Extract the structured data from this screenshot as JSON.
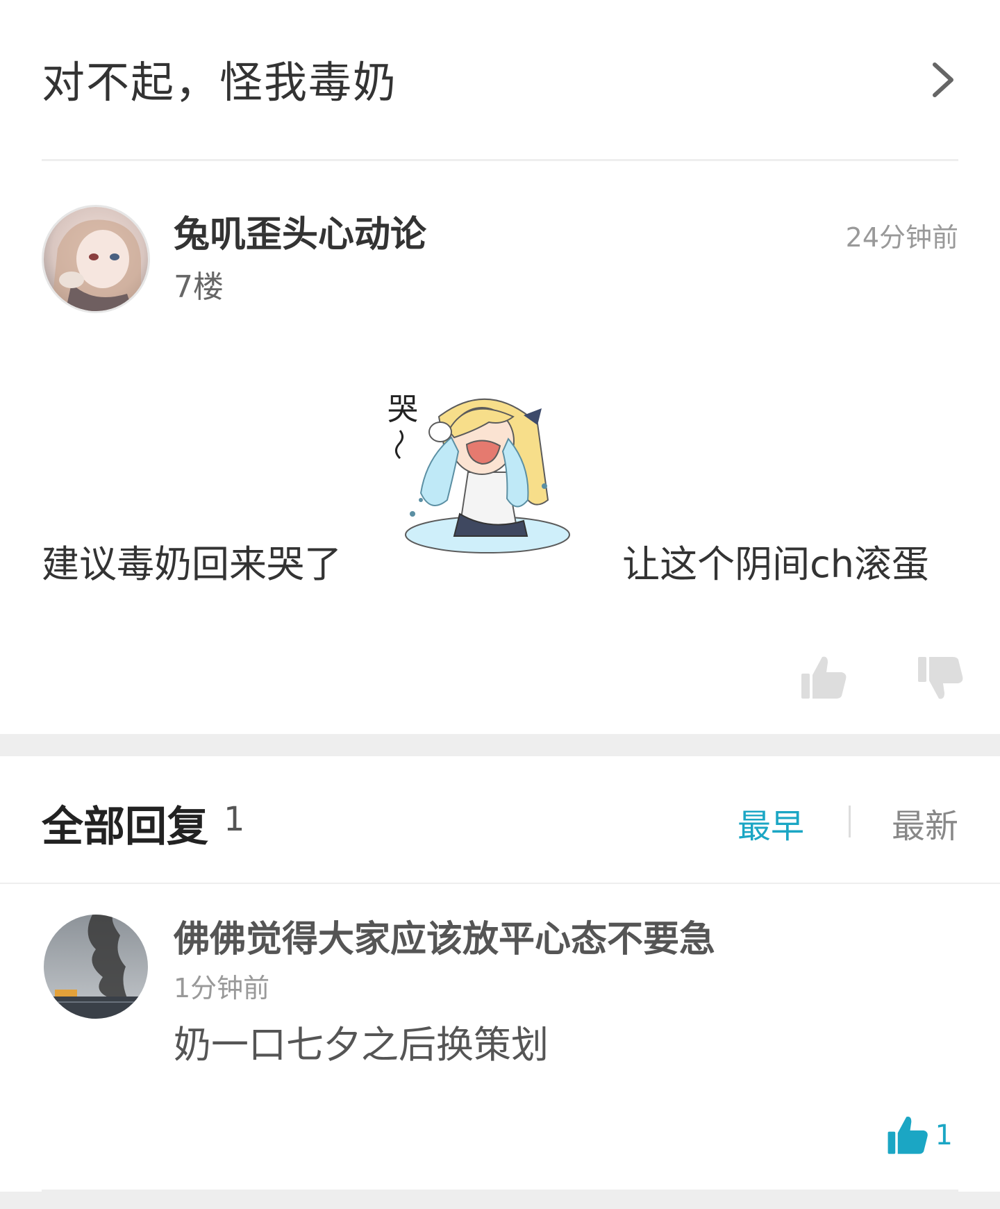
{
  "thread": {
    "title": "对不起，怪我毒奶"
  },
  "post": {
    "author": "兔叽歪头心动论",
    "floor": "7楼",
    "time": "24分钟前",
    "text_left": "建议毒奶回来哭了",
    "text_right": "让这个阴间ch滚蛋",
    "sticker_label": "哭"
  },
  "replies": {
    "title": "全部回复",
    "count": "1",
    "sort_earliest": "最早",
    "sort_latest": "最新"
  },
  "reply": {
    "author": "佛佛觉得大家应该放平心态不要急",
    "time": "1分钟前",
    "text": "奶一口七夕之后换策划",
    "like_count": "1"
  },
  "colors": {
    "accent": "#1ba6c4",
    "divider": "#eeeeee"
  }
}
